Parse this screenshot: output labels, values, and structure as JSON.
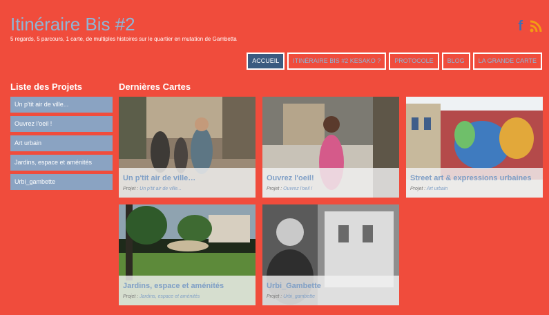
{
  "header": {
    "title": "Itinéraire Bis #2",
    "tagline": "5 regards, 5 parcours, 1 carte, de multiples histoires sur le quartier en mutation de Gambetta",
    "social": {
      "facebook_glyph": "f",
      "facebook_icon": "facebook-icon",
      "rss_icon": "rss-icon"
    }
  },
  "nav": [
    {
      "label": "ACCUEIL",
      "active": true
    },
    {
      "label": "ITINÉRAIRE BIS #2 KESAKO ?",
      "active": false
    },
    {
      "label": "PROTOCOLE",
      "active": false
    },
    {
      "label": "BLOG",
      "active": false
    },
    {
      "label": "LA GRANDE CARTE",
      "active": false
    }
  ],
  "sidebar": {
    "heading": "Liste des Projets",
    "items": [
      {
        "label": "Un p'tit air de ville..."
      },
      {
        "label": "Ouvrez l'oeil !"
      },
      {
        "label": "Art urbain"
      },
      {
        "label": "Jardins, espace et aménités"
      },
      {
        "label": "Urbi_gambette"
      }
    ]
  },
  "main": {
    "heading": "Dernières Cartes",
    "project_prefix": "Projet :",
    "cards": [
      {
        "title": "Un p'tit air de ville…",
        "project": "Un p'tit air de ville..."
      },
      {
        "title": "Ouvrez l'oeil!",
        "project": "Ouvrez l'oeil !"
      },
      {
        "title": "Street art & expressions urbaines",
        "project": "Art urbain"
      },
      {
        "title": "Jardins, espace et aménités",
        "project": "Jardins, espace et aménités"
      },
      {
        "title": "Urbi_Gambette",
        "project": "Urbi_gambette"
      }
    ]
  },
  "colors": {
    "background": "#f04c3c",
    "title": "#8fb5d6",
    "nav_active": "#3b5a80",
    "sidebar_item": "#8aa3c2",
    "card_title": "#7f9fc6"
  }
}
